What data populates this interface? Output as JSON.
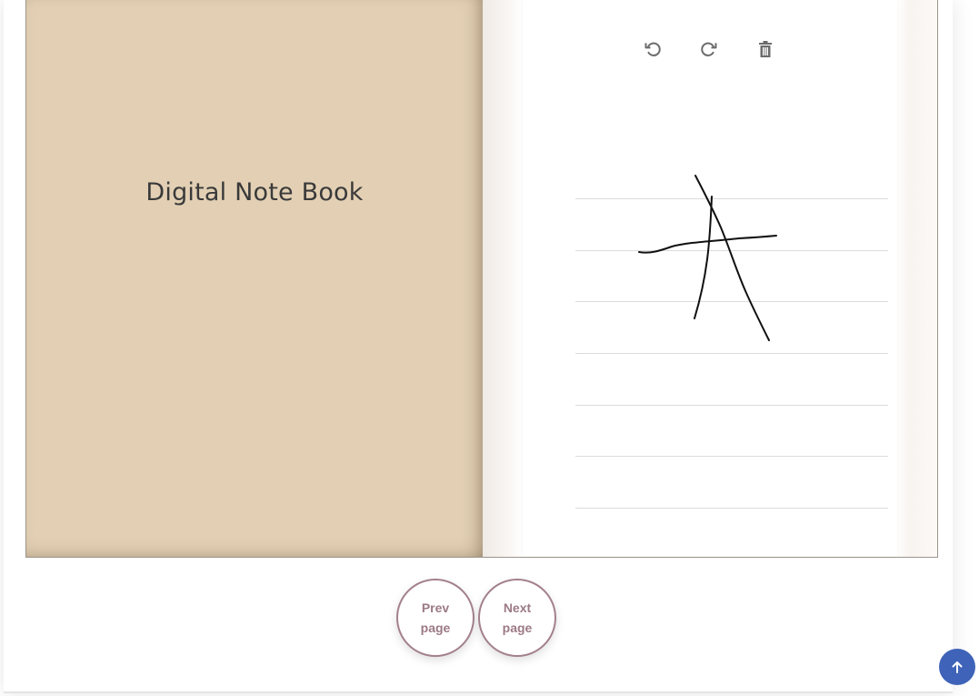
{
  "notebook": {
    "cover_title": "Digital Note Book"
  },
  "toolbar": {
    "undo_icon": "undo-icon",
    "redo_icon": "redo-icon",
    "clear_icon": "trash-icon"
  },
  "navigation": {
    "prev_label": "Prev page",
    "next_label": "Next page"
  },
  "scroll_top_icon": "arrow-up-icon",
  "colors": {
    "cover": "#e3d0b4",
    "nav_border": "#a3808c",
    "nav_text": "#9c7a86",
    "scroll_top": "#3f63b8",
    "icon": "#6b6b6b"
  }
}
